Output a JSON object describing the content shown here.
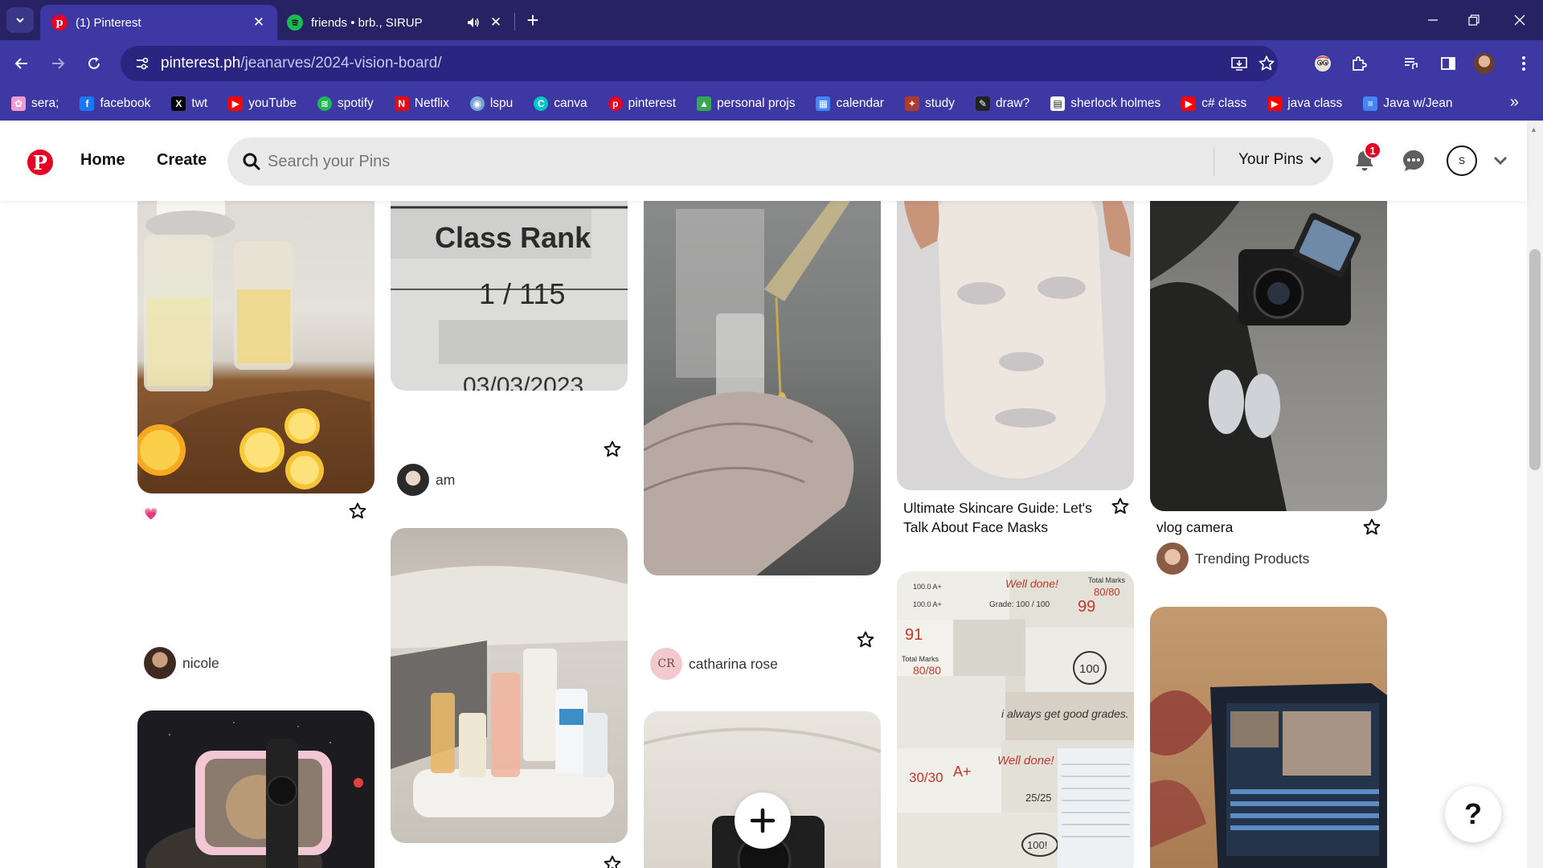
{
  "browser": {
    "tabs": [
      {
        "title": "(1) Pinterest",
        "active": true,
        "icon": "pinterest-icon"
      },
      {
        "title": "friends • brb., SIRUP",
        "active": false,
        "icon": "spotify-icon",
        "audio": true
      }
    ],
    "url_host": "pinterest.ph",
    "url_path": "/jeanarves/2024-vision-board/",
    "bookmarks": [
      {
        "label": "sera;",
        "icon": "flower-icon",
        "color": "#f29bd3"
      },
      {
        "label": "facebook",
        "icon": "facebook-icon",
        "color": "#1877f2"
      },
      {
        "label": "twt",
        "icon": "x-icon",
        "color": "#000000"
      },
      {
        "label": "youTube",
        "icon": "youtube-icon",
        "color": "#ff0000"
      },
      {
        "label": "spotify",
        "icon": "spotify-icon",
        "color": "#1db954"
      },
      {
        "label": "Netflix",
        "icon": "netflix-icon",
        "color": "#e50914"
      },
      {
        "label": "lspu",
        "icon": "lspu-icon",
        "color": "#7aa6d6"
      },
      {
        "label": "canva",
        "icon": "canva-icon",
        "color": "#00c4cc"
      },
      {
        "label": "pinterest",
        "icon": "pinterest-icon",
        "color": "#e60023"
      },
      {
        "label": "personal projs",
        "icon": "drive-icon",
        "color": "#34a853"
      },
      {
        "label": "calendar",
        "icon": "calendar-icon",
        "color": "#4285f4"
      },
      {
        "label": "study",
        "icon": "study-icon",
        "color": "#b03a2e"
      },
      {
        "label": "draw?",
        "icon": "draw-icon",
        "color": "#222222"
      },
      {
        "label": "sherlock holmes",
        "icon": "book-icon",
        "color": "#ffffff"
      },
      {
        "label": "c# class",
        "icon": "youtube-icon",
        "color": "#ff0000"
      },
      {
        "label": "java class",
        "icon": "youtube-icon",
        "color": "#ff0000"
      },
      {
        "label": "Java w/Jean",
        "icon": "docs-icon",
        "color": "#4285f4"
      }
    ]
  },
  "header": {
    "home": "Home",
    "create": "Create",
    "search_placeholder": "Search your Pins",
    "your_pins": "Your Pins",
    "notification_count": "1",
    "avatar_initial": "S",
    "brand_color": "#e60023"
  },
  "pins": {
    "lemon": {
      "title": "💗",
      "user": "nicole"
    },
    "rank": {
      "user": "am",
      "line1": "Class Rank",
      "line2": "1 / 115",
      "line3": "03/03/2023"
    },
    "oil": {
      "user": "catharina rose",
      "user_initials": "CR"
    },
    "mask": {
      "title": "Ultimate Skincare Guide: Let's Talk About Face Masks"
    },
    "camera": {
      "title": "vlog camera",
      "user": "Trending Products"
    },
    "grades": {
      "a": "100.0 A+",
      "b": "100.0 A+",
      "grade": "Grade:  100 / 100",
      "total": "Total Marks",
      "total_val": "80/80",
      "tm2": "Total Marks",
      "tm2_val": "80/80",
      "welldone": "Well done!",
      "welldone2": "Well done!",
      "affirm": "i always get good grades.",
      "g91": "91",
      "g99": "99",
      "g100": "100",
      "g3030": "30/30",
      "gA": "A+",
      "g25": "25/25",
      "g100b": "100!"
    }
  },
  "help": "?"
}
